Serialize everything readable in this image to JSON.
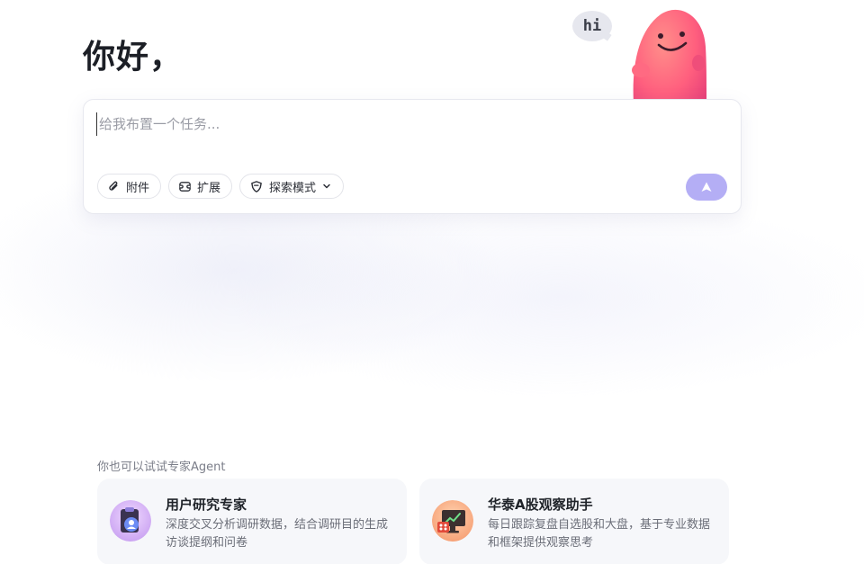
{
  "greeting": "你好，",
  "mascot": {
    "bubble_text": "hi",
    "icon": "pink-blob-mascot"
  },
  "composer": {
    "placeholder": "给我布置一个任务...",
    "value": "",
    "tools": [
      {
        "label": "附件",
        "icon": "paperclip-icon"
      },
      {
        "label": "扩展",
        "icon": "extension-icon"
      },
      {
        "label": "探索模式",
        "icon": "shield-icon",
        "has_dropdown": true
      }
    ],
    "send_icon": "send-arrow-icon"
  },
  "agents": {
    "section_label": "你也可以试试专家Agent",
    "items": [
      {
        "title": "用户研究专家",
        "desc": "深度交叉分析调研数据，结合调研目的生成访谈提纲和问卷",
        "icon": "clipboard-user-icon"
      },
      {
        "title": "华泰A股观察助手",
        "desc": "每日跟踪复盘自选股和大盘，基于专业数据和框架提供观察思考",
        "icon": "stock-monitor-icon"
      }
    ]
  },
  "colors": {
    "accent": "#b4aef5",
    "mascot_pink": "#ff6f8a",
    "card_bg": "#f6f7fa"
  }
}
